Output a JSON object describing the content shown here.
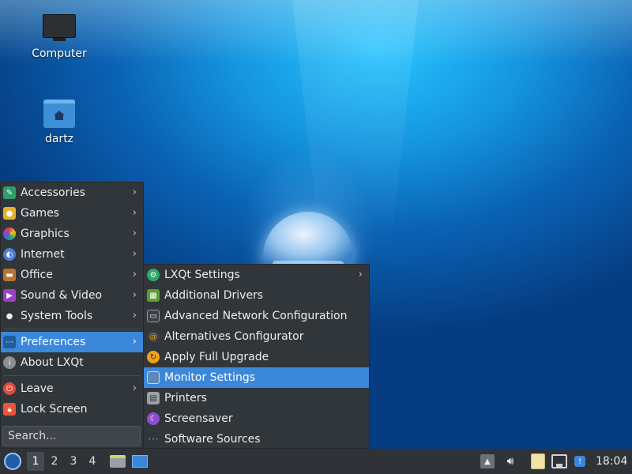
{
  "desktop": {
    "icons": [
      {
        "label": "Computer",
        "icon": "computer-icon"
      },
      {
        "label": "dartz",
        "icon": "home-folder-icon"
      }
    ]
  },
  "main_menu": {
    "items": [
      {
        "label": "Accessories",
        "icon": "accessories-icon",
        "color": "#2e9e6b"
      },
      {
        "label": "Games",
        "icon": "games-icon",
        "color": "#e8b02c"
      },
      {
        "label": "Graphics",
        "icon": "graphics-icon",
        "color": "#d9456b"
      },
      {
        "label": "Internet",
        "icon": "internet-icon",
        "color": "#4a7fd6"
      },
      {
        "label": "Office",
        "icon": "office-icon",
        "color": "#b8742c"
      },
      {
        "label": "Sound & Video",
        "icon": "sound-video-icon",
        "color": "#9b3fc4"
      },
      {
        "label": "System Tools",
        "icon": "system-tools-icon",
        "color": "#dddddd"
      },
      {
        "label": "Preferences",
        "icon": "preferences-icon",
        "color": "#3bb8e8"
      },
      {
        "label": "About LXQt",
        "icon": "about-icon",
        "color": "#8a8f94"
      },
      {
        "label": "Leave",
        "icon": "leave-icon",
        "color": "#e04a3f"
      },
      {
        "label": "Lock Screen",
        "icon": "lock-icon",
        "color": "#e8573b"
      }
    ],
    "search_placeholder": "Search..."
  },
  "preferences_submenu": {
    "items": [
      {
        "label": "LXQt Settings",
        "icon": "lxqt-settings-icon",
        "color": "#2ea86a"
      },
      {
        "label": "Additional Drivers",
        "icon": "drivers-icon",
        "color": "#5a9e2e"
      },
      {
        "label": "Advanced Network Configuration",
        "icon": "network-icon",
        "color": "#9aa0a6"
      },
      {
        "label": "Alternatives Configurator",
        "icon": "alternatives-icon",
        "color": "#c07a2c"
      },
      {
        "label": "Apply Full Upgrade",
        "icon": "upgrade-icon",
        "color": "#f0a21a"
      },
      {
        "label": "Monitor Settings",
        "icon": "monitor-icon",
        "color": "#5d88b8"
      },
      {
        "label": "Printers",
        "icon": "printer-icon",
        "color": "#9aa0a6"
      },
      {
        "label": "Screensaver",
        "icon": "screensaver-icon",
        "color": "#8e4cd0"
      },
      {
        "label": "Software Sources",
        "icon": "software-sources-icon",
        "color": "#3b6fd6"
      }
    ]
  },
  "taskbar": {
    "desktops": [
      "1",
      "2",
      "3",
      "4"
    ],
    "active_desktop": "1",
    "clock": "18:04"
  },
  "colors": {
    "menu_bg": "#31363b",
    "highlight": "#3b87d9",
    "taskbar_bg": "#2f3338"
  }
}
